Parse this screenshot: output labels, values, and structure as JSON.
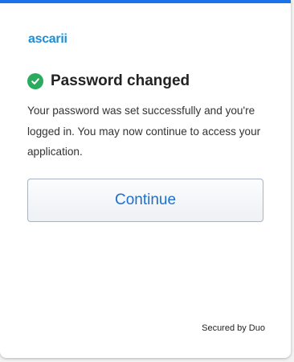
{
  "brand": {
    "logo_text": "ascarii",
    "logo_color": "#1f8ed6",
    "accent_color": "#1a73e8",
    "success_color": "#2bab5e"
  },
  "status": {
    "icon": "check-circle-icon",
    "title": "Password changed",
    "message": "Your password was set successfully and you're logged in. You may now continue to access your application."
  },
  "actions": {
    "continue_label": "Continue"
  },
  "footer": {
    "secured_by": "Secured by Duo"
  }
}
